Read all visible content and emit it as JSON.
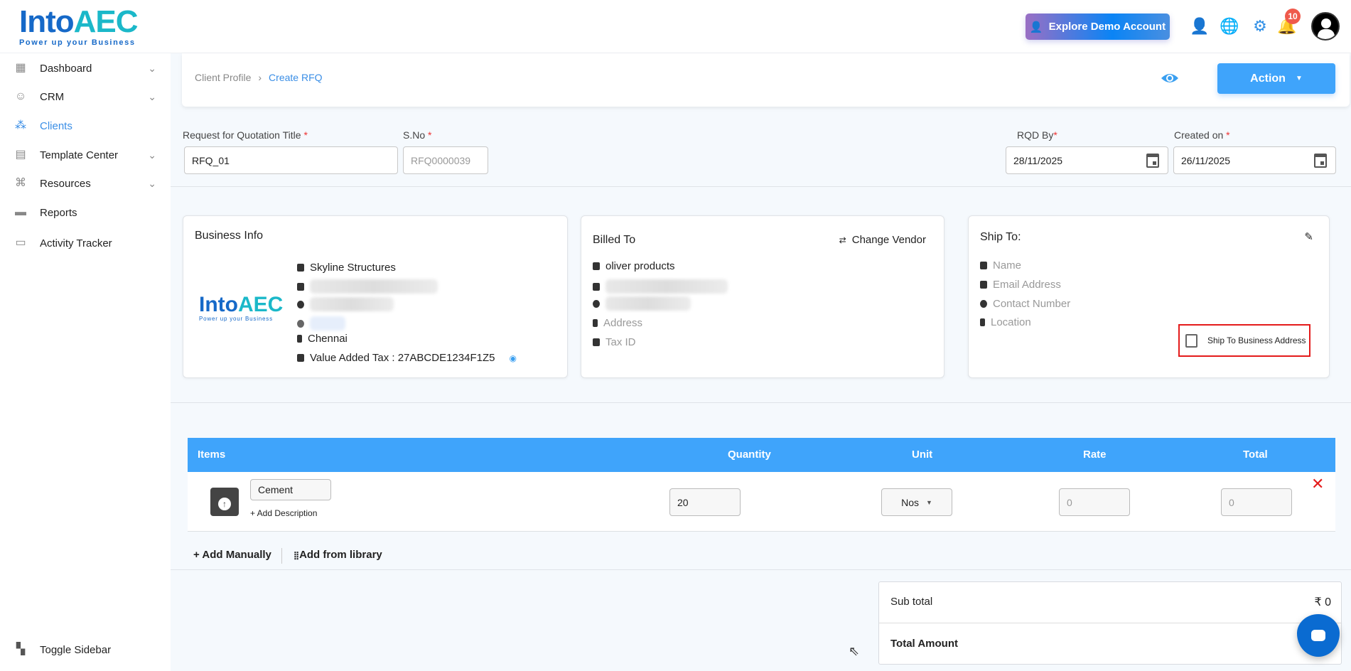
{
  "brand": {
    "name_a": "Into",
    "name_b": "AEC",
    "tagline": "Power up your Business"
  },
  "header": {
    "demo_label": "Explore Demo Account",
    "notifications": "10"
  },
  "sidebar": {
    "items": [
      {
        "label": "Dashboard",
        "icon": "dashboard-icon",
        "chevron": true
      },
      {
        "label": "CRM",
        "icon": "crm-icon",
        "chevron": true
      },
      {
        "label": "Clients",
        "icon": "clients-icon",
        "chevron": false,
        "active": true
      },
      {
        "label": "Template Center",
        "icon": "template-icon",
        "chevron": true
      },
      {
        "label": "Resources",
        "icon": "resources-icon",
        "chevron": true
      },
      {
        "label": "Reports",
        "icon": "reports-icon",
        "chevron": false
      },
      {
        "label": "Activity Tracker",
        "icon": "activity-icon",
        "chevron": false
      }
    ],
    "toggle": "Toggle Sidebar"
  },
  "breadcrumb": {
    "parent": "Client Profile",
    "current": "Create RFQ"
  },
  "action_label": "Action",
  "form": {
    "title_label": "Request for Quotation Title",
    "title_value": "RFQ_01",
    "sno_label": "S.No",
    "sno_placeholder": "RFQ0000039",
    "rqd_label": "RQD By",
    "rqd_value": "28/11/2025",
    "created_label": "Created on",
    "created_value": "26/11/2025",
    "required": "*"
  },
  "business": {
    "title": "Business Info",
    "name": "Skyline Structures",
    "location": "Chennai",
    "vat": "Value Added Tax : 27ABCDE1234F1Z5"
  },
  "billed": {
    "title": "Billed To",
    "change_vendor": "Change Vendor",
    "name": "oliver products",
    "address": "Address",
    "tax": "Tax ID"
  },
  "ship": {
    "title": "Ship To:",
    "name": "Name",
    "email": "Email Address",
    "contact": "Contact Number",
    "location": "Location",
    "checkbox_label": "Ship To Business Address"
  },
  "table": {
    "headers": [
      "Items",
      "Quantity",
      "Unit",
      "Rate",
      "Total"
    ],
    "rows": [
      {
        "item": "Cement",
        "add_desc": "+ Add Description",
        "qty": "20",
        "unit": "Nos",
        "rate": "0",
        "total": "0"
      }
    ]
  },
  "add_manually": "+ Add Manually",
  "add_library": "Add from library",
  "summary": {
    "subtotal_label": "Sub total",
    "subtotal_value": "₹ 0",
    "total_label": "Total Amount"
  },
  "colors": {
    "accent": "#3fa4fb",
    "danger": "#e41b1b"
  }
}
